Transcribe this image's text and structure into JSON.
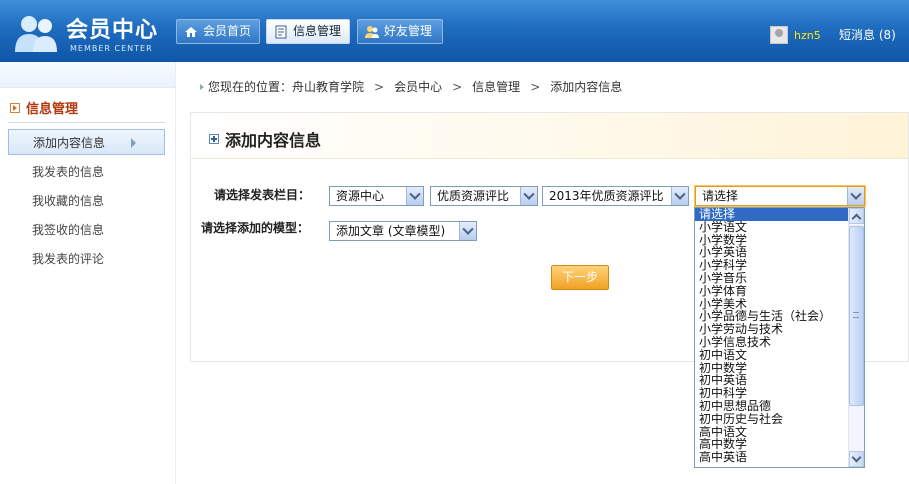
{
  "header": {
    "logo_title": "会员中心",
    "logo_subtitle": "MEMBER CENTER",
    "tabs": [
      {
        "label": "会员首页",
        "icon": "home-icon"
      },
      {
        "label": "信息管理",
        "icon": "document-icon",
        "active": true
      },
      {
        "label": "好友管理",
        "icon": "friends-icon"
      }
    ],
    "username": "hzn5",
    "messages_label": "短消息 (8)"
  },
  "sidebar": {
    "section_title": "信息管理",
    "items": [
      {
        "label": "添加内容信息",
        "active": true
      },
      {
        "label": "我发表的信息"
      },
      {
        "label": "我收藏的信息"
      },
      {
        "label": "我签收的信息"
      },
      {
        "label": "我发表的评论"
      }
    ]
  },
  "breadcrumb": {
    "prefix": "您现在的位置：",
    "items": [
      "舟山教育学院",
      "会员中心",
      "信息管理",
      "添加内容信息"
    ],
    "separator": ">"
  },
  "form": {
    "panel_title": "添加内容信息",
    "column_label": "请选择发表栏目：",
    "column_selects": [
      "资源中心",
      "优质资源评比",
      "2013年优质资源评比",
      "请选择"
    ],
    "model_label": "请选择添加的模型：",
    "model_select": "添加文章 (文章模型)",
    "next_button": "下一步"
  },
  "dropdown": {
    "options": [
      "请选择",
      "小学语文",
      "小学数学",
      "小学英语",
      "小学科学",
      "小学音乐",
      "小学体育",
      "小学美术",
      "小学品德与生活（社会）",
      "小学劳动与技术",
      "小学信息技术",
      "初中语文",
      "初中数学",
      "初中英语",
      "初中科学",
      "初中思想品德",
      "初中历史与社会",
      "高中语文",
      "高中数学",
      "高中英语"
    ],
    "highlighted_index": 0
  },
  "colors": {
    "header_blue": "#1f6cc0",
    "username_yellow": "#ffea00",
    "sidebar_title": "#b4380e",
    "button_orange": "#f0a124",
    "select_highlight": "#316ac5"
  }
}
